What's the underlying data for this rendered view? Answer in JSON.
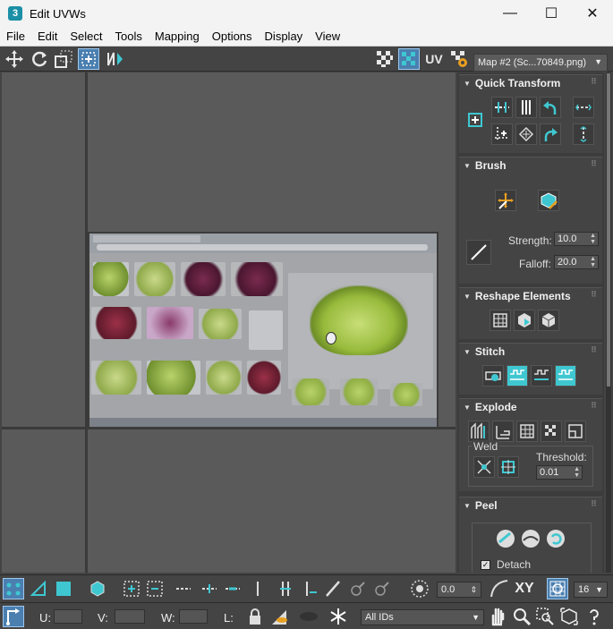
{
  "window": {
    "app_icon": "3",
    "title": "Edit UVWs",
    "minimize": "—",
    "maximize": "☐",
    "close": "✕"
  },
  "menu": [
    "File",
    "Edit",
    "Select",
    "Tools",
    "Mapping",
    "Options",
    "Display",
    "View"
  ],
  "toolbar_top": {
    "uv_label": "UV",
    "map_dropdown": "Map #2 (Sc...70849.png)"
  },
  "panel": {
    "quick_transform": {
      "title": "Quick Transform"
    },
    "brush": {
      "title": "Brush",
      "strength_label": "Strength:",
      "strength_value": "10.0",
      "falloff_label": "Falloff:",
      "falloff_value": "20.0"
    },
    "reshape": {
      "title": "Reshape Elements"
    },
    "stitch": {
      "title": "Stitch"
    },
    "explode": {
      "title": "Explode",
      "weld_label": "Weld",
      "threshold_label": "Threshold:",
      "threshold_value": "0.01"
    },
    "peel": {
      "title": "Peel",
      "detach_label": "Detach",
      "detach_checked": "✓"
    }
  },
  "bottom1": {
    "angle_value": "0.0",
    "xy_label": "XY",
    "grid_value": "16"
  },
  "bottom2": {
    "u_label": "U:",
    "v_label": "V:",
    "w_label": "W:",
    "l_label": "L:",
    "ids_dropdown": "All IDs"
  },
  "colors": {
    "accent": "#3fc7d1",
    "active_button": "#4a7fb0",
    "panel_bg": "#444444"
  }
}
